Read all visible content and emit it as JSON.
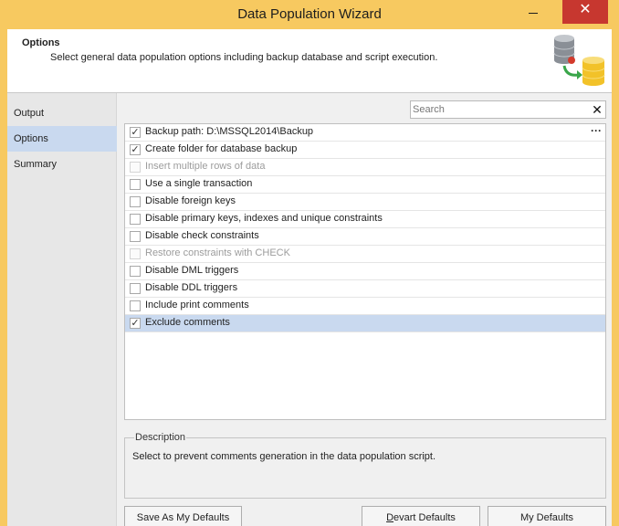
{
  "window": {
    "title": "Data Population Wizard",
    "close_glyph": "✕"
  },
  "header": {
    "title": "Options",
    "description": "Select general data population options including backup database and script execution.",
    "icon": "database-wizard-icon",
    "colors": {
      "db_gray": "#8a8f96",
      "db_gold": "#f2c229",
      "arrow_green": "#3aa64a",
      "arrow_red": "#d33a2c"
    }
  },
  "nav": {
    "items": [
      {
        "label": "Output",
        "active": false
      },
      {
        "label": "Options",
        "active": true
      },
      {
        "label": "Summary",
        "active": false
      }
    ]
  },
  "search": {
    "placeholder": "Search",
    "value": "",
    "clear_glyph": "✕"
  },
  "options": [
    {
      "label": "Backup path: D:\\MSSQL2014\\Backup",
      "checked": true,
      "enabled": true,
      "selected": false,
      "has_browse": true,
      "browse_label": "···"
    },
    {
      "label": "Create folder for database backup",
      "checked": true,
      "enabled": true,
      "selected": false
    },
    {
      "label": "Insert multiple rows of data",
      "checked": false,
      "enabled": false,
      "selected": false
    },
    {
      "label": "Use a single transaction",
      "checked": false,
      "enabled": true,
      "selected": false
    },
    {
      "label": "Disable foreign keys",
      "checked": false,
      "enabled": true,
      "selected": false
    },
    {
      "label": "Disable primary keys, indexes and unique constraints",
      "checked": false,
      "enabled": true,
      "selected": false
    },
    {
      "label": "Disable check constraints",
      "checked": false,
      "enabled": true,
      "selected": false
    },
    {
      "label": "Restore constraints with CHECK",
      "checked": false,
      "enabled": false,
      "selected": false
    },
    {
      "label": "Disable DML triggers",
      "checked": false,
      "enabled": true,
      "selected": false
    },
    {
      "label": "Disable DDL triggers",
      "checked": false,
      "enabled": true,
      "selected": false
    },
    {
      "label": "Include print comments",
      "checked": false,
      "enabled": true,
      "selected": false
    },
    {
      "label": "Exclude comments",
      "checked": true,
      "enabled": true,
      "selected": true
    }
  ],
  "description": {
    "title": "Description",
    "text": "Select to prevent comments generation in the data population script."
  },
  "buttons": {
    "save_defaults": "Save As My Defaults",
    "devart_defaults_first": "D",
    "devart_defaults_rest": "evart Defaults",
    "my_defaults": "My Defaults"
  },
  "colors": {
    "title_bar": "#f7c960",
    "close_button": "#c7372f",
    "selection": "#c9d9ef",
    "check_glyph": "✓"
  }
}
